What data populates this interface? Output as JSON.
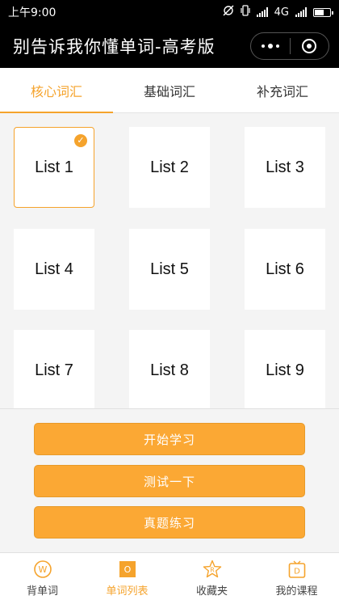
{
  "status_bar": {
    "time": "上午9:00",
    "network": "4G"
  },
  "nav": {
    "title": "别告诉我你懂单词-高考版"
  },
  "tabs": [
    {
      "label": "核心词汇",
      "active": true
    },
    {
      "label": "基础词汇",
      "active": false
    },
    {
      "label": "补充词汇",
      "active": false
    }
  ],
  "lists": [
    "List 1",
    "List 2",
    "List 3",
    "List 4",
    "List 5",
    "List 6",
    "List 7",
    "List 8",
    "List 9"
  ],
  "selected_list": "List 1",
  "buttons": {
    "start": "开始学习",
    "test": "测试一下",
    "practice": "真题练习"
  },
  "tabbar": [
    {
      "label": "背单词",
      "icon": "W",
      "icon_name": "memorize-w-icon"
    },
    {
      "label": "单词列表",
      "icon": "O",
      "icon_name": "word-list-o-icon",
      "active": true
    },
    {
      "label": "收藏夹",
      "icon": "R",
      "icon_name": "favorites-star-r-icon"
    },
    {
      "label": "我的课程",
      "icon": "D",
      "icon_name": "courses-tv-d-icon"
    }
  ],
  "colors": {
    "accent": "#f5a32c",
    "button": "#fba834"
  }
}
